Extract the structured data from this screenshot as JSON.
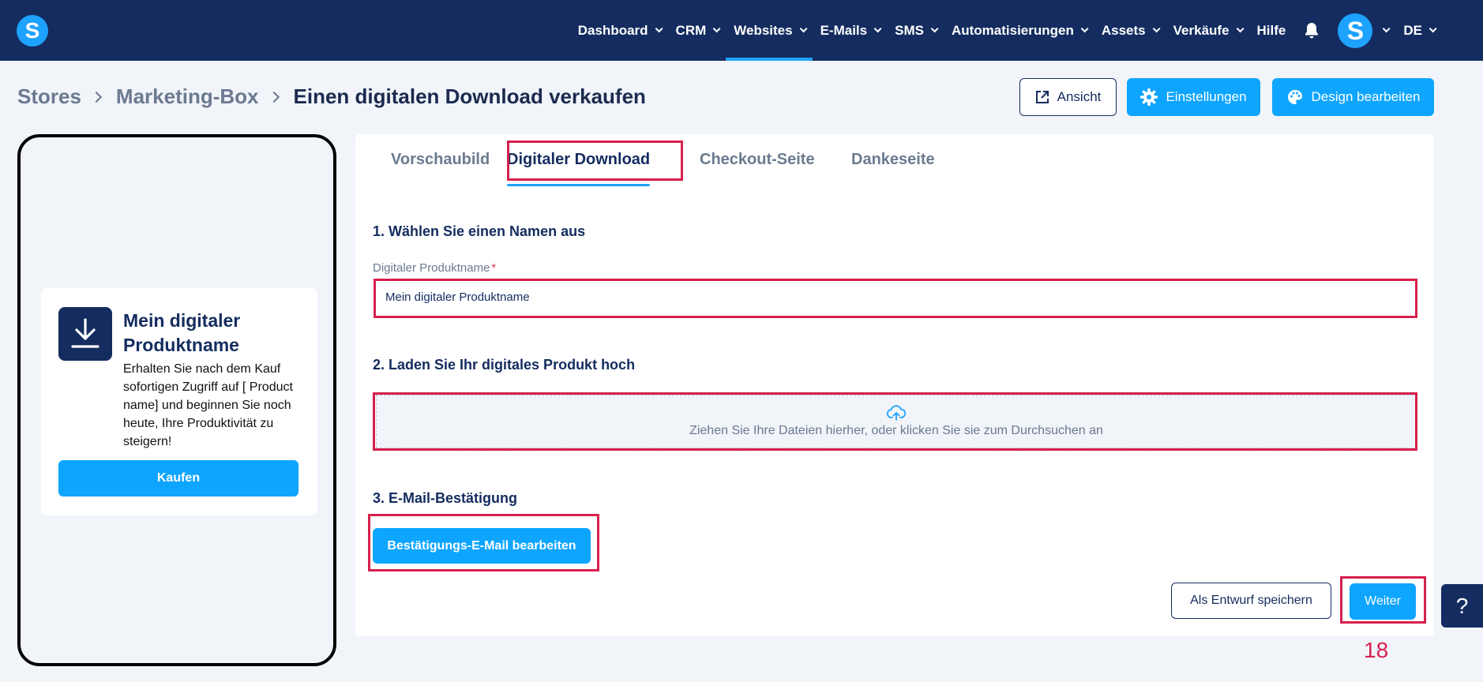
{
  "brand": {
    "logo_letter": "S",
    "accent_color": "#1ea2ff",
    "nav_bg": "#142c5f"
  },
  "nav": {
    "items": [
      {
        "label": "Dashboard",
        "has_dropdown": true
      },
      {
        "label": "CRM",
        "has_dropdown": true
      },
      {
        "label": "Websites",
        "has_dropdown": true,
        "active": true
      },
      {
        "label": "E-Mails",
        "has_dropdown": true
      },
      {
        "label": "SMS",
        "has_dropdown": true
      },
      {
        "label": "Automatisierungen",
        "has_dropdown": true
      },
      {
        "label": "Assets",
        "has_dropdown": true
      },
      {
        "label": "Verkäufe",
        "has_dropdown": true
      },
      {
        "label": "Hilfe",
        "has_dropdown": false
      }
    ],
    "avatar_letter": "S",
    "language": "DE"
  },
  "breadcrumb": {
    "items": [
      "Stores",
      "Marketing-Box"
    ],
    "current": "Einen digitalen Download verkaufen"
  },
  "header_buttons": {
    "ansicht": "Ansicht",
    "einstellungen": "Einstellungen",
    "design": "Design bearbeiten"
  },
  "preview": {
    "title": "Mein digitaler Produktname",
    "description": "Erhalten Sie nach dem Kauf sofortigen Zugriff auf [ Product name] und beginnen Sie noch heute, Ihre Produktivität zu steigern!",
    "buy_label": "Kaufen"
  },
  "tabs": [
    {
      "label": "Vorschaubild",
      "active": false
    },
    {
      "label": "Digitaler Download",
      "active": true
    },
    {
      "label": "Checkout-Seite",
      "active": false
    },
    {
      "label": "Dankeseite",
      "active": false
    }
  ],
  "form": {
    "section1_title": "1. Wählen Sie einen Namen aus",
    "name_label": "Digitaler Produktname",
    "name_required_mark": "*",
    "name_value": "Mein digitaler Produktname",
    "section2_title": "2. Laden Sie Ihr digitales Produkt hoch",
    "upload_text": "Ziehen Sie Ihre Dateien hierher, oder klicken Sie sie zum Durchsuchen an",
    "section3_title": "3. E-Mail-Bestätigung",
    "email_button": "Bestätigungs-E-Mail bearbeiten",
    "draft_button": "Als Entwurf speichern",
    "next_button": "Weiter"
  },
  "annotation": {
    "step_number": "18",
    "highlight_color": "#d6204d"
  },
  "help": {
    "label": "?"
  }
}
